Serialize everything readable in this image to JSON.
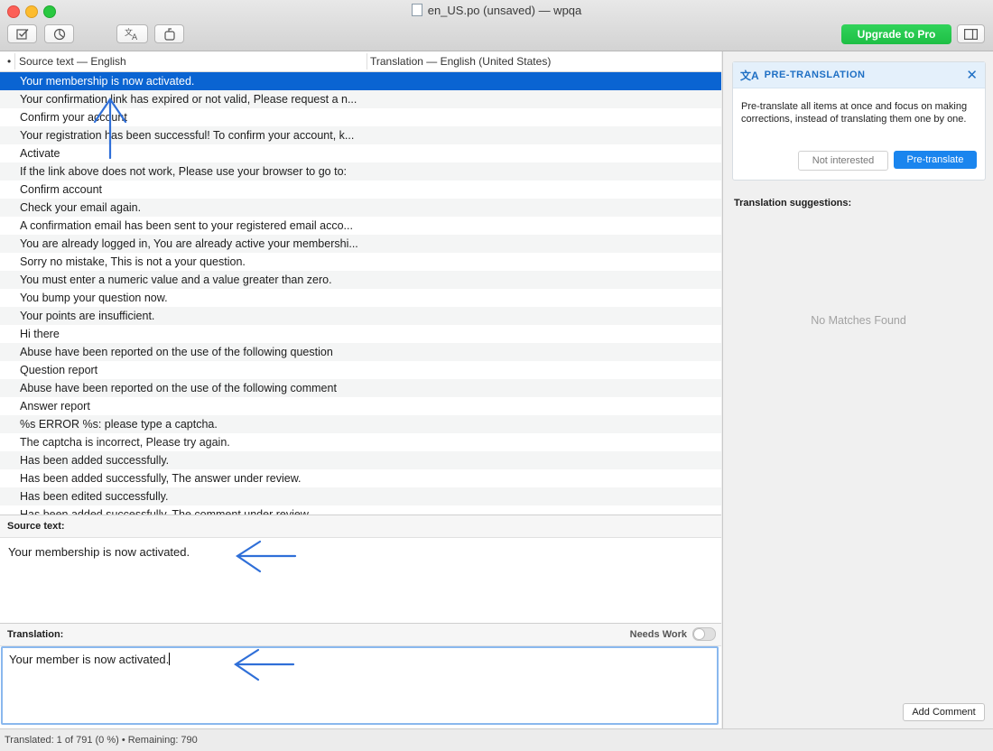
{
  "window": {
    "title": "en_US.po (unsaved) — wpqa",
    "upgrade_label": "Upgrade to Pro"
  },
  "icons": {
    "validate": "checkbox-icon",
    "stats": "pie-chart-icon",
    "pretranslate": "translate-icon",
    "sync": "update-icon",
    "sidebar": "sidebar-icon"
  },
  "list": {
    "dot": "•",
    "col_source": "Source text — English",
    "col_translation": "Translation — English (United States)",
    "rows": [
      "Your membership is now activated.",
      "Your confirmation link has expired or not valid, Please request a n...",
      "Confirm your account",
      "Your registration has been successful! To confirm your account, k...",
      "Activate",
      "If the link above does not work, Please use your browser to go to:",
      "Confirm account",
      "Check your email again.",
      "A confirmation email has been sent to your registered email acco...",
      "You are already logged in, You are already active your membershi...",
      "Sorry no mistake, This is not a your question.",
      "You must enter a numeric value and a value greater than zero.",
      "You bump your question now.",
      "Your points are insufficient.",
      "Hi there",
      "Abuse have been reported on the use of the following question",
      "Question report",
      "Abuse have been reported on the use of the following comment",
      "Answer report",
      "%s ERROR %s: please type a captcha.",
      "The captcha is incorrect, Please try again.",
      "Has been added successfully.",
      "Has been added successfully, The answer under review.",
      "Has been edited successfully.",
      "Has been added successfully, The comment under review."
    ]
  },
  "source": {
    "label": "Source text:",
    "text": "Your membership is now activated."
  },
  "translation": {
    "label": "Translation:",
    "needs_work": "Needs Work",
    "text": "Your member is now activated."
  },
  "status": {
    "text": "Translated: 1 of 791 (0 %)  •  Remaining: 790"
  },
  "pretranslation": {
    "title": "PRE-TRANSLATION",
    "body": "Pre-translate all items at once and focus on making corrections, instead of translating them one by one.",
    "not_interested": "Not interested",
    "pretranslate": "Pre-translate"
  },
  "suggestions": {
    "label": "Translation suggestions:",
    "empty": "No Matches Found"
  },
  "add_comment": "Add Comment",
  "colors": {
    "selection": "#0a64d2",
    "accent": "#1a85ee",
    "upgrade": "#22c55e",
    "annotation_arrow": "#2f6fd8"
  }
}
